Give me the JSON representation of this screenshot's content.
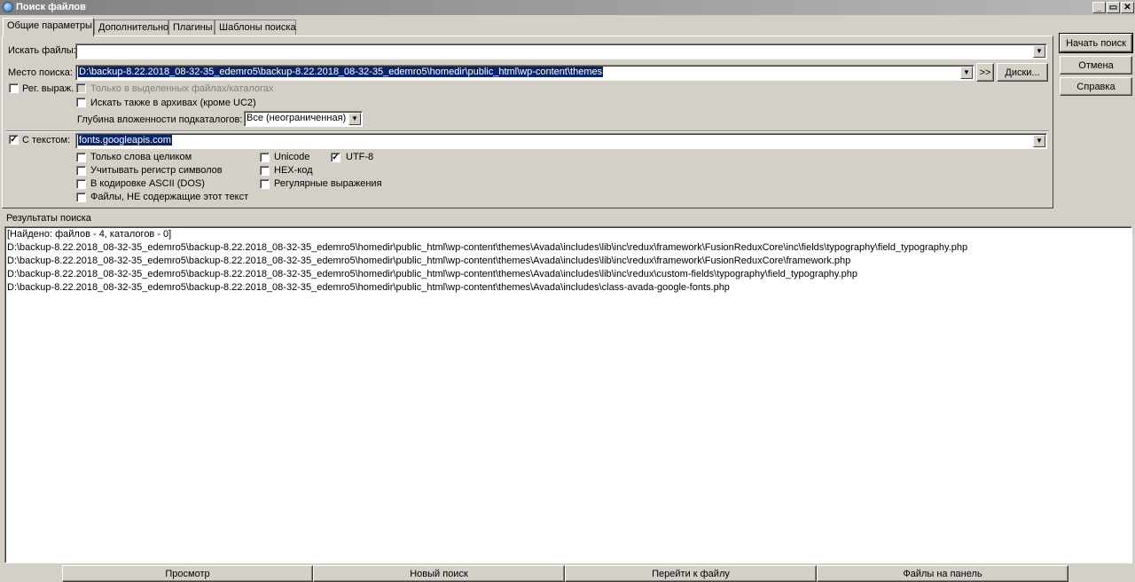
{
  "window": {
    "title": "Поиск файлов",
    "controls": [
      "_",
      "▭",
      "✕"
    ]
  },
  "tabs": [
    {
      "label": "Общие параметры",
      "active": true
    },
    {
      "label": "Дополнительно"
    },
    {
      "label": "Плагины"
    },
    {
      "label": "Шаблоны поиска"
    }
  ],
  "form": {
    "search_files_label": "Искать файлы:",
    "search_files_value": "",
    "location_label": "Место поиска:",
    "location_value": "D:\\backup-8.22.2018_08-32-35_edemro5\\backup-8.22.2018_08-32-35_edemro5\\homedir\\public_html\\wp-content\\themes",
    "browse_label": ">>",
    "drives_label": "Диски...",
    "regex_label": "Рег. выраж.",
    "only_selected_label": "Только в выделенных файлах/каталогах",
    "search_archives_label": "Искать также в архивах (кроме UC2)",
    "depth_label": "Глубина вложенности подкаталогов:",
    "depth_value": "Все (неограниченная)",
    "with_text_label": "С текстом:",
    "with_text_value": "fonts.googleapis.com",
    "options": {
      "whole_words": "Только слова целиком",
      "case_sensitive": "Учитывать регистр символов",
      "ascii_dos": "В кодировке ASCII (DOS)",
      "not_containing": "Файлы, НЕ содержащие этот текст",
      "unicode": "Unicode",
      "hex": "HEX-код",
      "regex": "Регулярные выражения",
      "utf8": "UTF-8"
    }
  },
  "side_buttons": {
    "start": "Начать поиск",
    "cancel": "Отмена",
    "help": "Справка"
  },
  "results": {
    "label": "Результаты поиска",
    "summary": "[Найдено: файлов - 4, каталогов - 0]",
    "items": [
      "D:\\backup-8.22.2018_08-32-35_edemro5\\backup-8.22.2018_08-32-35_edemro5\\homedir\\public_html\\wp-content\\themes\\Avada\\includes\\lib\\inc\\redux\\framework\\FusionReduxCore\\inc\\fields\\typography\\field_typography.php",
      "D:\\backup-8.22.2018_08-32-35_edemro5\\backup-8.22.2018_08-32-35_edemro5\\homedir\\public_html\\wp-content\\themes\\Avada\\includes\\lib\\inc\\redux\\framework\\FusionReduxCore\\framework.php",
      "D:\\backup-8.22.2018_08-32-35_edemro5\\backup-8.22.2018_08-32-35_edemro5\\homedir\\public_html\\wp-content\\themes\\Avada\\includes\\lib\\inc\\redux\\custom-fields\\typography\\field_typography.php",
      "D:\\backup-8.22.2018_08-32-35_edemro5\\backup-8.22.2018_08-32-35_edemro5\\homedir\\public_html\\wp-content\\themes\\Avada\\includes\\class-avada-google-fonts.php"
    ]
  },
  "bottom_buttons": {
    "view": "Просмотр",
    "new_search": "Новый поиск",
    "go_to_file": "Перейти к файлу",
    "to_panel": "Файлы на панель"
  }
}
